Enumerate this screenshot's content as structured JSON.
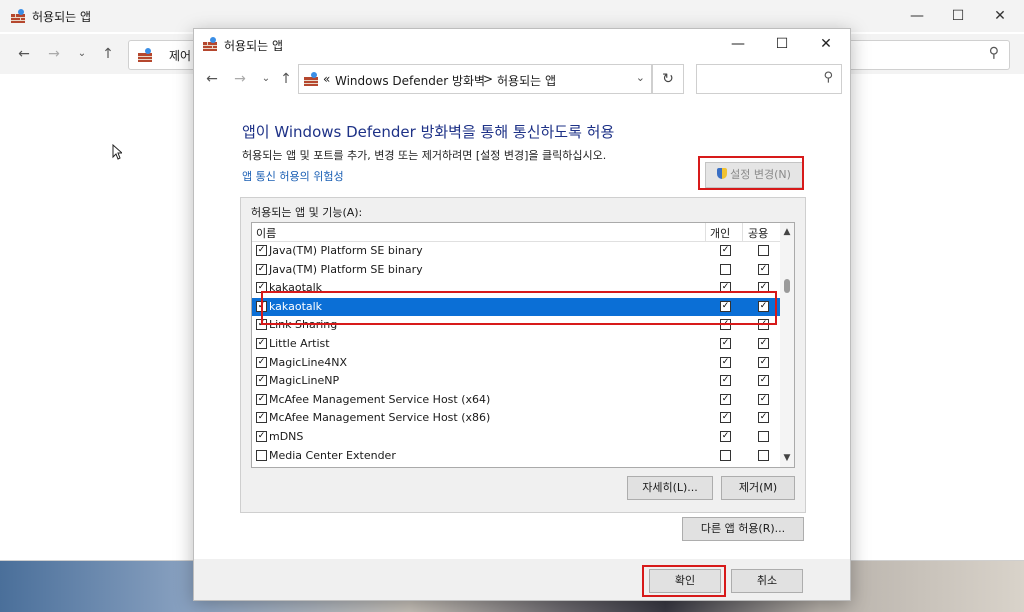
{
  "background_window": {
    "title": "허용되는 앱",
    "address_text": "제어"
  },
  "dialog": {
    "title": "허용되는 앱",
    "breadcrumb": {
      "prefix": "«",
      "item1": "Windows Defender 방화벽",
      "separator": ">",
      "item2": "허용되는 앱"
    },
    "heading": "앱이 Windows Defender 방화벽을 통해 통신하도록 허용",
    "description": "허용되는 앱 및 포트를 추가, 변경 또는 제거하려면 [설정 변경]을 클릭하십시오.",
    "risk_link": "앱 통신 허용의 위험성",
    "settings_button": "설정 변경(N)",
    "group_label": "허용되는 앱 및 기능(A):",
    "columns": {
      "name": "이름",
      "private": "개인",
      "public": "공용"
    },
    "apps": [
      {
        "name": "Java(TM) Platform SE binary",
        "enabled": true,
        "private": true,
        "public": false
      },
      {
        "name": "Java(TM) Platform SE binary",
        "enabled": true,
        "private": false,
        "public": true
      },
      {
        "name": "kakaotalk",
        "enabled": true,
        "private": true,
        "public": true
      },
      {
        "name": "kakaotalk",
        "enabled": true,
        "private": true,
        "public": true
      },
      {
        "name": "Link Sharing",
        "enabled": true,
        "private": true,
        "public": true
      },
      {
        "name": "Little Artist",
        "enabled": true,
        "private": true,
        "public": true
      },
      {
        "name": "MagicLine4NX",
        "enabled": true,
        "private": true,
        "public": true
      },
      {
        "name": "MagicLineNP",
        "enabled": true,
        "private": true,
        "public": true
      },
      {
        "name": "McAfee Management Service Host (x64)",
        "enabled": true,
        "private": true,
        "public": true
      },
      {
        "name": "McAfee Management Service Host (x86)",
        "enabled": true,
        "private": true,
        "public": true
      },
      {
        "name": "mDNS",
        "enabled": true,
        "private": true,
        "public": false
      },
      {
        "name": "Media Center Extender",
        "enabled": false,
        "private": false,
        "public": false
      }
    ],
    "selected_row": 3,
    "details_button": "자세히(L)...",
    "remove_button": "제거(M)",
    "allow_other_button": "다른 앱 허용(R)...",
    "ok_button": "확인",
    "cancel_button": "취소"
  },
  "colors": {
    "highlight": "#d71a1a",
    "selection": "#0b6fd6",
    "heading": "#1e3287",
    "link": "#1a5fb4"
  }
}
